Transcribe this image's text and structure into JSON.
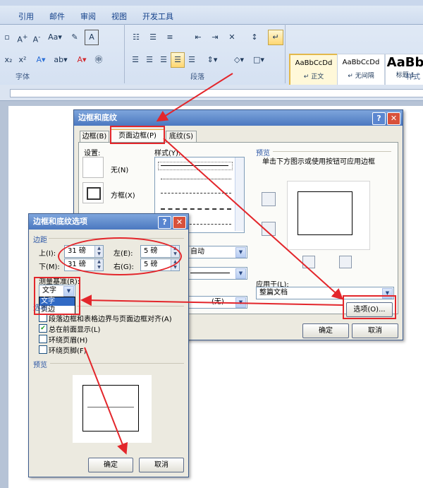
{
  "window_title": "文档1 - Microsoft Word",
  "ribbon": {
    "tabs": [
      "引用",
      "邮件",
      "审阅",
      "视图",
      "开发工具"
    ],
    "groups": {
      "font": "字体",
      "paragraph": "段落",
      "styles": "样式"
    },
    "styles": [
      {
        "preview": "AaBbCcDd",
        "name": "↵ 正文"
      },
      {
        "preview": "AaBbCcDd",
        "name": "↵ 无间隔"
      },
      {
        "preview": "AaBb",
        "name": "标题 1"
      }
    ]
  },
  "borders_dialog": {
    "title": "边框和底纹",
    "tabs": [
      "边框(B)",
      "页面边框(P)",
      "底纹(S)"
    ],
    "setting_label": "设置:",
    "settings": [
      "无(N)",
      "方框(X)"
    ],
    "style_label": "样式(Y):",
    "color_value": "自动",
    "art_value": "(无)",
    "preview_label": "预览",
    "preview_hint": "单击下方图示或使用按钮可应用边框",
    "apply_to_label": "应用于(L):",
    "apply_to_value": "整篇文档",
    "options_button": "选项(O)...",
    "ok_button": "确定",
    "cancel_button": "取消"
  },
  "options_dialog": {
    "title": "边框和底纹选项",
    "margin_label": "边距",
    "top_label": "上(I):",
    "top_value": "31 磅",
    "bottom_label": "下(M):",
    "bottom_value": "31 磅",
    "left_label": "左(E):",
    "left_value": "5 磅",
    "right_label": "右(G):",
    "right_value": "5 磅",
    "measure_label": "测量基准(R):",
    "measure_value": "文字",
    "measure_options": [
      "文字",
      "页边"
    ],
    "options_label": "选项",
    "checkboxes": [
      {
        "label": "段落边框和表格边界与页面边框对齐(A)",
        "checked": false
      },
      {
        "label": "总在前面显示(L)",
        "checked": true
      },
      {
        "label": "环绕页眉(H)",
        "checked": false
      },
      {
        "label": "环绕页脚(F)",
        "checked": false
      }
    ],
    "preview_label": "预览",
    "ok_button": "确定",
    "cancel_button": "取消"
  },
  "colors": {
    "annotation": "#e3262b",
    "title_bar": "#4b78c0"
  }
}
